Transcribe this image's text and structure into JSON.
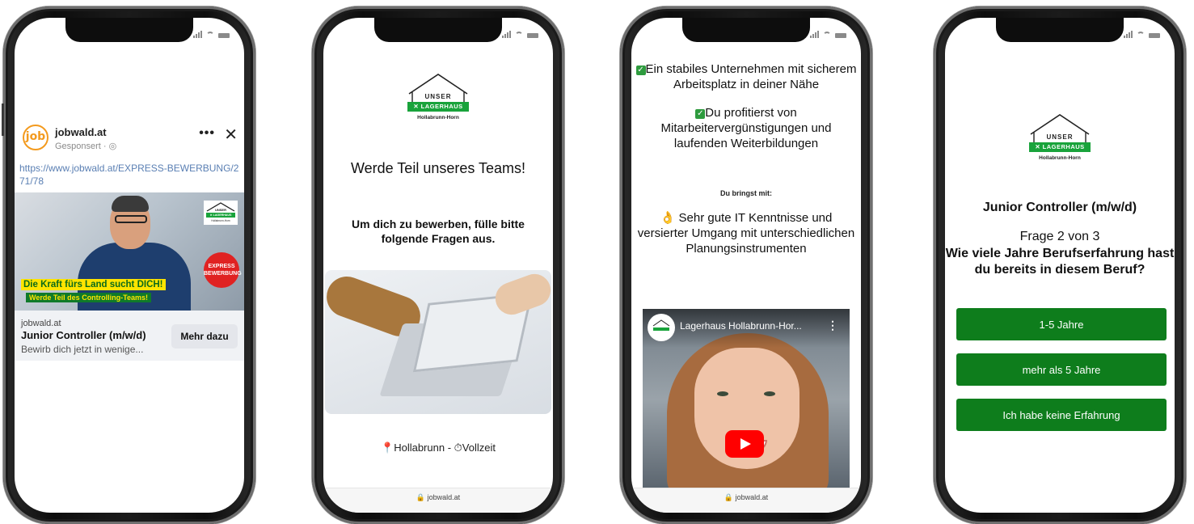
{
  "phone1": {
    "logo_text": "job",
    "page_name": "jobwald.at",
    "sponsored": "Gesponsert · ◎",
    "more": "•••",
    "close": "✕",
    "url": "https://www.jobwald.at/EXPRESS-BEWERBUNG/271/78",
    "ad_headline": "Die Kraft fürs Land sucht DICH!",
    "ad_subline": "Werde Teil des Controlling-Teams!",
    "express_line1": "EXPRESS",
    "express_line2": "BEWERBUNG",
    "mini_logo": {
      "unser": "UNSER",
      "bar": "✕ LAGERHAUS",
      "loc": "Hollabrunn-Horn"
    },
    "site": "jobwald.at",
    "job_title": "Junior Controller (m/w/d)",
    "description": "Bewirb dich jetzt in wenige...",
    "cta": "Mehr dazu"
  },
  "brand": {
    "unser": "UNSER",
    "bar": "✕ LAGERHAUS",
    "loc": "Hollabrunn-Horn"
  },
  "phone2": {
    "title": "Werde Teil unseres Teams!",
    "instruction": "Um dich zu bewerben, fülle bitte folgende Fragen aus.",
    "location_icon": "📍",
    "location": "Hollabrunn - ",
    "time_icon": "⏱",
    "time": "Vollzeit",
    "footer_url": "🔒 jobwald.at"
  },
  "phone3": {
    "benefit1": "Ein stabiles Unternehmen mit sicherem Arbeitsplatz in deiner Nähe",
    "benefit2": "Du profitierst von Mitarbeitervergünstigungen und laufenden Weiterbildungen",
    "bring_heading": "Du bringst mit:",
    "requirement1": "Sehr gute IT Kenntnisse und versierter Umgang mit unterschiedlichen Planungsinstrumenten",
    "check_icon": "✓",
    "hand_icon": "👌",
    "video_title": "Lagerhaus Hollabrunn-Hor...",
    "video_more": "⋮",
    "footer_url": "🔒 jobwald.at"
  },
  "phone4": {
    "job_title": "Junior Controller (m/w/d)",
    "step": "Frage 2 von 3",
    "question": "Wie viele Jahre Berufserfahrung hast du bereits in diesem Beruf?",
    "options": [
      "1-5 Jahre",
      "mehr als 5 Jahre",
      "Ich habe keine Erfahrung"
    ]
  }
}
